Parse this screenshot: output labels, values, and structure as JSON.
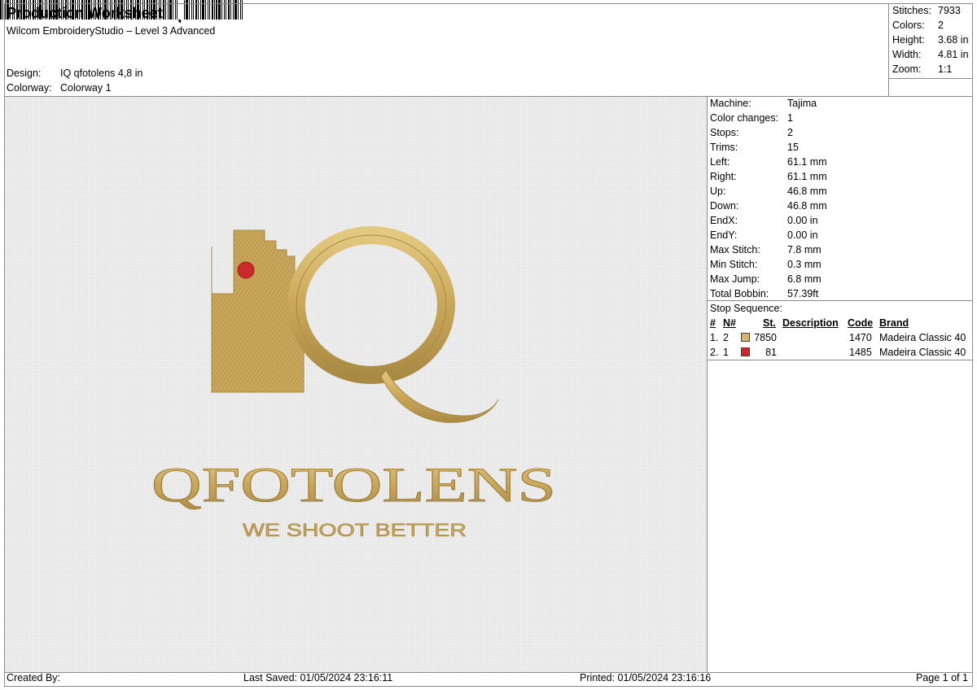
{
  "header": {
    "title": "Production Worksheet",
    "subtitle": "Wilcom EmbroideryStudio – Level 3 Advanced",
    "design_label": "Design:",
    "design_value": "IQ qfotolens 4,8 in",
    "colorway_label": "Colorway:",
    "colorway_value": "Colorway 1"
  },
  "summary": [
    {
      "label": "Stitches:",
      "value": "7933"
    },
    {
      "label": "Colors:",
      "value": "2"
    },
    {
      "label": "Height:",
      "value": "3.68 in"
    },
    {
      "label": "Width:",
      "value": "4.81 in"
    },
    {
      "label": "Zoom:",
      "value": "1:1"
    }
  ],
  "machine_info": [
    {
      "label": "Machine:",
      "value": "Tajima"
    },
    {
      "label": "Color changes:",
      "value": "1"
    },
    {
      "label": "Stops:",
      "value": "2"
    },
    {
      "label": "Trims:",
      "value": "15"
    },
    {
      "label": "Left:",
      "value": "61.1 mm"
    },
    {
      "label": "Right:",
      "value": "61.1 mm"
    },
    {
      "label": "Up:",
      "value": "46.8 mm"
    },
    {
      "label": "Down:",
      "value": "46.8 mm"
    },
    {
      "label": "EndX:",
      "value": "0.00 in"
    },
    {
      "label": "EndY:",
      "value": "0.00 in"
    },
    {
      "label": "Max Stitch:",
      "value": "7.8 mm"
    },
    {
      "label": "Min Stitch:",
      "value": "0.3 mm"
    },
    {
      "label": "Max Jump:",
      "value": "6.8 mm"
    },
    {
      "label": "Total Bobbin:",
      "value": "57.39ft"
    }
  ],
  "stop_sequence": {
    "title": "Stop Sequence:",
    "columns": {
      "num": "#",
      "n": "N#",
      "st": "St.",
      "description": "Description",
      "code": "Code",
      "brand": "Brand"
    },
    "rows": [
      {
        "num": "1.",
        "n": "2",
        "color": "#d8b266",
        "st": "7850",
        "description": "",
        "code": "1470",
        "brand": "Madeira Classic 40"
      },
      {
        "num": "2.",
        "n": "1",
        "color": "#cc2a2a",
        "st": "81",
        "description": "",
        "code": "1485",
        "brand": "Madeira Classic 40"
      }
    ]
  },
  "design": {
    "brand_text": "QFOTOLENS",
    "tagline": "WE SHOOT BETTER",
    "thread_gold": "#c9a75a",
    "thread_red": "#cc2a2a"
  },
  "footer": {
    "created_by": "Created By:",
    "last_saved": "Last Saved: 01/05/2024 23:16:11",
    "printed": "Printed: 01/05/2024 23:16:16",
    "page": "Page 1 of 1"
  }
}
